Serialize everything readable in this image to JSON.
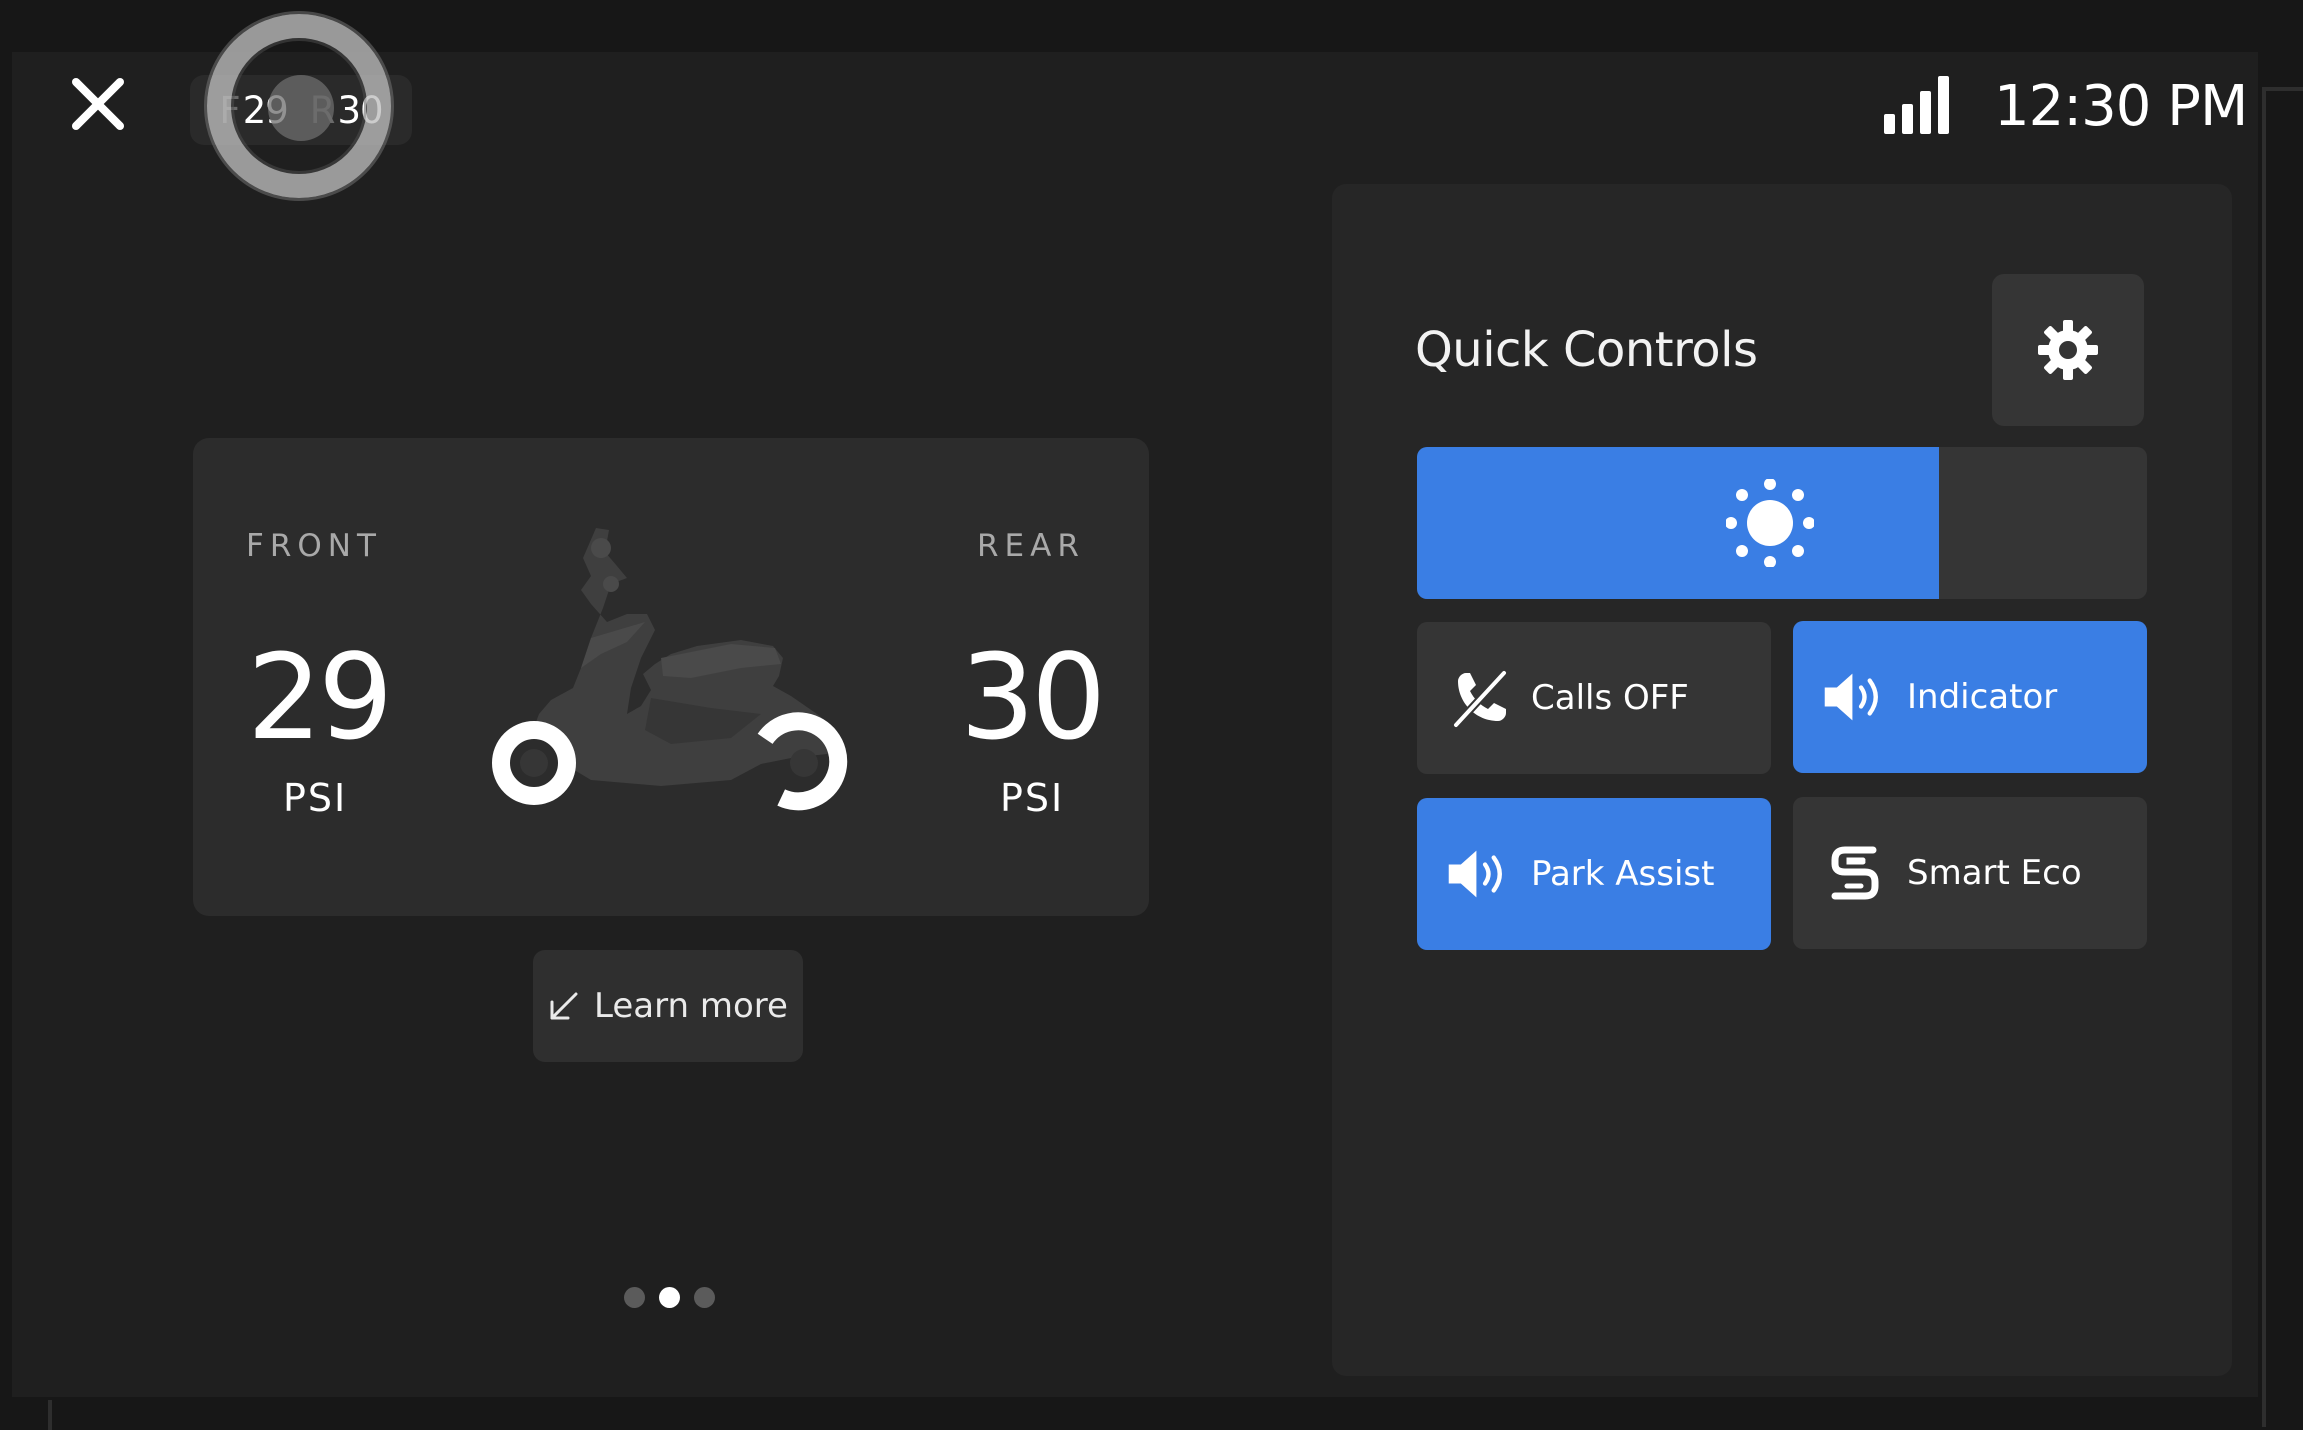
{
  "status_bar": {
    "close_icon": "close-icon",
    "tire_chip": {
      "front_label": "F",
      "front_value": "29",
      "rear_label": "R",
      "rear_value": "30"
    },
    "signal_icon": "signal-strength-icon",
    "time": "12:30 PM"
  },
  "tire_card": {
    "front": {
      "label": "FRONT",
      "value": "29",
      "unit": "PSI"
    },
    "rear": {
      "label": "REAR",
      "value": "30",
      "unit": "PSI"
    },
    "image": "scooter-illustration"
  },
  "learn_more": {
    "label": "Learn more",
    "icon": "arrow-down-left-icon"
  },
  "pagination": {
    "count": 3,
    "active_index": 1
  },
  "quick_controls": {
    "title": "Quick Controls",
    "settings_icon": "gear-icon",
    "brightness": {
      "icon": "sun-icon",
      "level": 0.715
    },
    "tiles": [
      {
        "label": "Calls OFF",
        "icon": "calls-off-icon",
        "active": false
      },
      {
        "label": "Indicator",
        "icon": "speaker-icon",
        "active": true
      },
      {
        "label": "Park Assist",
        "icon": "speaker-icon",
        "active": true
      },
      {
        "label": "Smart Eco",
        "icon": "smart-eco-icon",
        "active": false
      }
    ]
  },
  "colors": {
    "accent": "#3a7ee4",
    "background": "#1f1f1f",
    "panel": "#262626",
    "tile_off": "#353535"
  }
}
